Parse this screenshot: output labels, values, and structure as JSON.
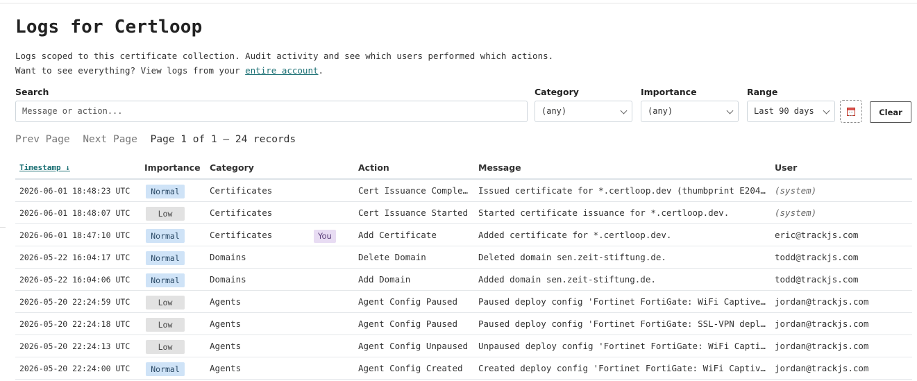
{
  "title": "Logs for Certloop",
  "description": {
    "line1": "Logs scoped to this certificate collection. Audit activity and see which users performed which actions.",
    "line2_prefix": "Want to see everything? View logs from your ",
    "line2_link": "entire account",
    "line2_suffix": "."
  },
  "filters": {
    "search_label": "Search",
    "search_placeholder": "Message or action...",
    "category_label": "Category",
    "category_value": "(any)",
    "importance_label": "Importance",
    "importance_value": "(any)",
    "range_label": "Range",
    "range_value": "Last 90 days",
    "calendar_icon": "calendar-icon",
    "clear_label": "Clear"
  },
  "pager": {
    "prev": "Prev Page",
    "next": "Next Page",
    "info": "Page 1 of 1 — 24 records"
  },
  "table": {
    "headers": {
      "timestamp": "Timestamp ↓",
      "importance": "Importance",
      "category": "Category",
      "action": "Action",
      "message": "Message",
      "user": "User"
    },
    "rows": [
      {
        "time": "2026-06-01 18:48:23 UTC",
        "importance": "Normal",
        "category": "Certificates",
        "tag": "",
        "action": "Cert Issuance Comple…",
        "message": "Issued certificate for *.certloop.dev (thumbprint E2049…",
        "user": "(system)"
      },
      {
        "time": "2026-06-01 18:48:07 UTC",
        "importance": "Low",
        "category": "Certificates",
        "tag": "",
        "action": "Cert Issuance Started",
        "message": "Started certificate issuance for *.certloop.dev.",
        "user": "(system)"
      },
      {
        "time": "2026-06-01 18:47:10 UTC",
        "importance": "Normal",
        "category": "Certificates",
        "tag": "You",
        "action": "Add Certificate",
        "message": "Added certificate for *.certloop.dev.",
        "user": "eric@trackjs.com"
      },
      {
        "time": "2026-05-22 16:04:17 UTC",
        "importance": "Normal",
        "category": "Domains",
        "tag": "",
        "action": "Delete Domain",
        "message": "Deleted domain sen.zeit-stiftung.de.",
        "user": "todd@trackjs.com"
      },
      {
        "time": "2026-05-22 16:04:06 UTC",
        "importance": "Normal",
        "category": "Domains",
        "tag": "",
        "action": "Add Domain",
        "message": "Added domain sen.zeit-stiftung.de.",
        "user": "todd@trackjs.com"
      },
      {
        "time": "2026-05-20 22:24:59 UTC",
        "importance": "Low",
        "category": "Agents",
        "tag": "",
        "action": "Agent Config Paused",
        "message": "Paused deploy config 'Fortinet FortiGate: WiFi Captive …",
        "user": "jordan@trackjs.com"
      },
      {
        "time": "2026-05-20 22:24:18 UTC",
        "importance": "Low",
        "category": "Agents",
        "tag": "",
        "action": "Agent Config Paused",
        "message": "Paused deploy config 'Fortinet FortiGate: SSL-VPN deplo…",
        "user": "jordan@trackjs.com"
      },
      {
        "time": "2026-05-20 22:24:13 UTC",
        "importance": "Low",
        "category": "Agents",
        "tag": "",
        "action": "Agent Config Unpaused",
        "message": "Unpaused deploy config 'Fortinet FortiGate: WiFi Captiv…",
        "user": "jordan@trackjs.com"
      },
      {
        "time": "2026-05-20 22:24:00 UTC",
        "importance": "Normal",
        "category": "Agents",
        "tag": "",
        "action": "Agent Config Created",
        "message": "Created deploy config 'Fortinet FortiGate: WiFi Captive…",
        "user": "jordan@trackjs.com"
      }
    ]
  }
}
